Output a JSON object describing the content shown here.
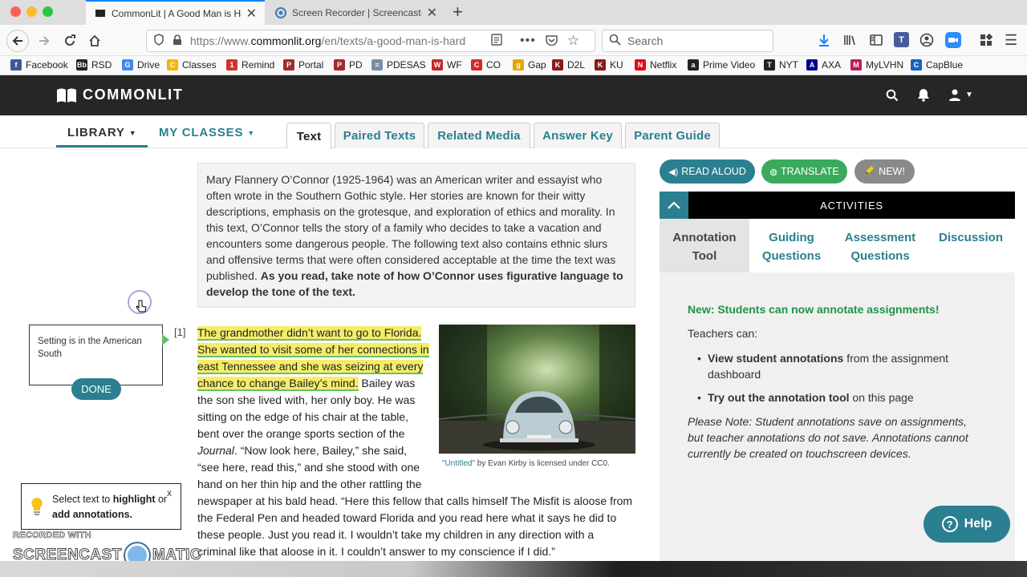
{
  "browser": {
    "tabs": [
      {
        "title": "CommonLit | A Good Man is Ha"
      },
      {
        "title": "Screen Recorder | Screencast-"
      }
    ],
    "new_tab_symbol": "+",
    "url_prefix": "https://www.",
    "url_host": "commonlit.org",
    "url_path": "/en/texts/a-good-man-is-hard",
    "search_placeholder": "Search",
    "bookmarks": [
      {
        "label": "Facebook",
        "icon": "f",
        "color": "#3b5998"
      },
      {
        "label": "RSD",
        "icon": "Bb",
        "color": "#222222"
      },
      {
        "label": "Drive",
        "icon": "G",
        "color": "#4285f4"
      },
      {
        "label": "Classes",
        "icon": "C",
        "color": "#f4b400"
      },
      {
        "label": "Remind",
        "icon": "1",
        "color": "#d0342c"
      },
      {
        "label": "Portal",
        "icon": "P",
        "color": "#a52a2a"
      },
      {
        "label": "PD",
        "icon": "P",
        "color": "#a52a2a"
      },
      {
        "label": "PDESAS",
        "icon": "≡",
        "color": "#7a8fa6"
      },
      {
        "label": "WF",
        "icon": "W",
        "color": "#c62828"
      },
      {
        "label": "CO",
        "icon": "C",
        "color": "#d62828"
      },
      {
        "label": "Gap",
        "icon": "g",
        "color": "#e8a600"
      },
      {
        "label": "D2L",
        "icon": "K",
        "color": "#8b1a1a"
      },
      {
        "label": "KU",
        "icon": "K",
        "color": "#8b1a1a"
      },
      {
        "label": "Netflix",
        "icon": "N",
        "color": "#e50914"
      },
      {
        "label": "Prime Video",
        "icon": "a",
        "color": "#222222"
      },
      {
        "label": "NYT",
        "icon": "T",
        "color": "#222222"
      },
      {
        "label": "AXA",
        "icon": "A",
        "color": "#00008f"
      },
      {
        "label": "MyLVHN",
        "icon": "M",
        "color": "#c2185b"
      },
      {
        "label": "CapBlue",
        "icon": "C",
        "color": "#1565c0"
      }
    ]
  },
  "site": {
    "logo": "COMMONLIT",
    "nav": {
      "library": "LIBRARY",
      "my_classes": "MY CLASSES"
    },
    "tabs": [
      "Text",
      "Paired Texts",
      "Related Media",
      "Answer Key",
      "Parent Guide"
    ],
    "active_tab": "Text"
  },
  "reading": {
    "intro": "Mary Flannery O’Connor (1925-1964) was an American writer and essayist who often wrote in the Southern Gothic style. Her stories are known for their witty descriptions, emphasis on the grotesque, and exploration of ethics and morality. In this text, O’Connor tells the story of a family who decides to take a vacation and encounters some dangerous people. The following text also contains ethnic slurs and offensive terms that were often considered acceptable at the time the text was published.",
    "intro_bold": "As you read, take note of how O’Connor uses figurative language to develop the tone of the text.",
    "para_number": "[1]",
    "highlighted": "The grandmother didn’t want to go to Florida. She wanted to visit some of her connections in east Tennessee and she was seizing at every chance to change Bailey’s mind.",
    "body_before_journal": " Bailey was the son she lived with, her only boy. He was sitting on the edge of his chair at the table, bent over the orange sports section of the ",
    "journal": "Journal",
    "body_after_journal": ". “Now look here, Bailey,” she said, “see here, read this,” and she stood with one hand on her thin hip and the other rattling the newspaper at his bald head. “Here this fellow that calls himself The Misfit is aloose from the Federal Pen and headed toward Florida and you read here what it says he did to these people. Just you read it. I wouldn’t take my children in any direction with a criminal like that aloose in it. I couldn’t answer to my conscience if I did.”",
    "caption_link": "\"Untitled\"",
    "caption_rest": " by Evan Kirby is licensed under CC0."
  },
  "panel": {
    "read_aloud": "READ ALOUD",
    "translate": "TRANSLATE",
    "new": "NEW!",
    "activities": "ACTIVITIES",
    "tabs": [
      {
        "line1": "Annotation",
        "line2": "Tool"
      },
      {
        "line1": "Guiding",
        "line2": "Questions"
      },
      {
        "line1": "Assessment",
        "line2": "Questions"
      },
      {
        "line1": "Discussion",
        "line2": ""
      }
    ],
    "announcement": "New: Students can now annotate assignments!",
    "teachers_can": "Teachers can:",
    "bullet1_bold": "View student annotations",
    "bullet1_rest": " from the assignment dashboard",
    "bullet2_bold": "Try out the annotation tool",
    "bullet2_rest": " on this page",
    "note": "Please Note: Student annotations save on assignments, but teacher annotations do not save. Annotations cannot currently be created on touchscreen devices.",
    "help": "Help"
  },
  "annotation": {
    "text": "Setting is in the American South",
    "done": "DONE"
  },
  "tip": {
    "prefix": "Select text to ",
    "bold1": "highlight",
    "middle": " or ",
    "bold2": "add annotations.",
    "close": "x"
  },
  "watermark": {
    "line1": "RECORDED WITH",
    "line2a": "SCREENCAST",
    "line2b": "MATIC"
  },
  "colors": {
    "teal": "#2a7f90",
    "green": "#3aaa5c",
    "header": "#262626",
    "highlight": "#f5ed6a"
  }
}
